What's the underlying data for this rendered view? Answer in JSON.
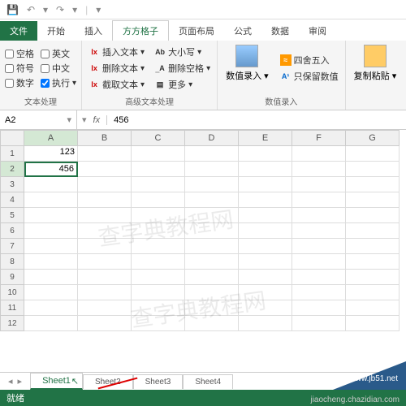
{
  "qat": {
    "save": "💾",
    "undo": "↶",
    "redo": "↷"
  },
  "tabs": {
    "file": "文件",
    "home": "开始",
    "insert": "插入",
    "ffgz": "方方格子",
    "layout": "页面布局",
    "formula": "公式",
    "data": "数据",
    "review": "审阅"
  },
  "ribbon": {
    "g1": {
      "space": "空格",
      "english": "英文",
      "symbol": "符号",
      "chinese": "中文",
      "number": "数字",
      "execute": "执行",
      "label": "文本处理"
    },
    "g2": {
      "insert": "插入文本",
      "delete": "删除文本",
      "extract": "截取文本",
      "case": "大小写",
      "delspace": "删除空格",
      "more": "更多",
      "label": "高级文本处理"
    },
    "g3": {
      "input": "数值录入",
      "round": "四舍五入",
      "keep": "只保留数值",
      "label": "数值录入"
    },
    "g4": {
      "paste": "复制粘贴"
    }
  },
  "namebox": {
    "ref": "A2",
    "fx": "fx",
    "formula": "456"
  },
  "cols": [
    "A",
    "B",
    "C",
    "D",
    "E",
    "F",
    "G"
  ],
  "rows": [
    "1",
    "2",
    "3",
    "4",
    "5",
    "6",
    "7",
    "8",
    "9",
    "10",
    "11",
    "12"
  ],
  "cells": {
    "a1": "123",
    "a2": "456"
  },
  "sheets": {
    "s1": "Sheet1",
    "s2": "Sheet2",
    "s3": "Sheet3",
    "s4": "Sheet4"
  },
  "status": "就绪",
  "watermark": "查字典教程网",
  "footer": "jiaocheng.chazidian.com",
  "site": "www.jb51.net"
}
